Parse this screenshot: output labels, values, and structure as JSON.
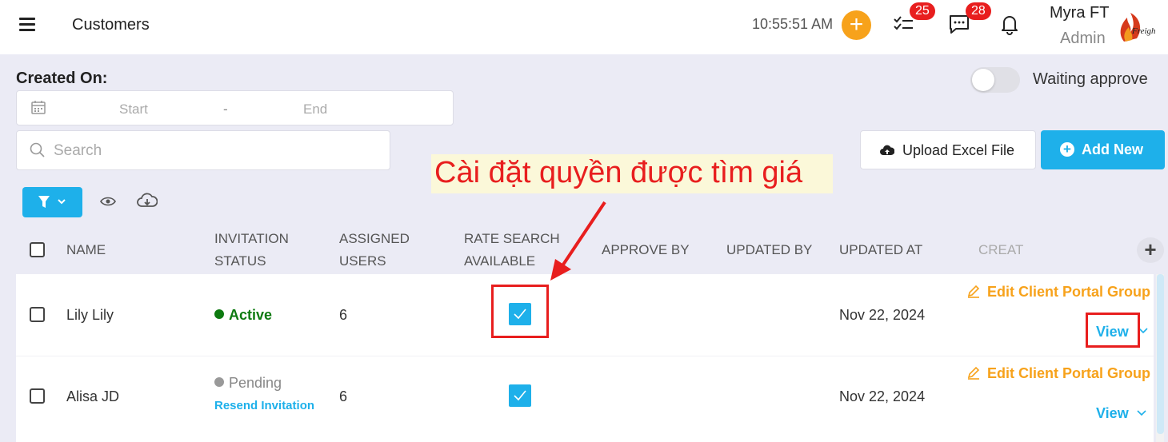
{
  "header": {
    "page_title": "Customers",
    "clock": "10:55:51 AM",
    "tasks_badge": "25",
    "messages_badge": "28",
    "user_name": "Myra FT",
    "user_role": "Admin",
    "icons": [
      "menu-icon",
      "add-icon",
      "checklist-icon",
      "chat-icon",
      "bell-icon"
    ]
  },
  "filters": {
    "created_on_label": "Created On:",
    "start_placeholder": "Start",
    "range_separator": "-",
    "end_placeholder": "End",
    "search_placeholder": "Search",
    "waiting_toggle_label": "Waiting approve",
    "waiting_toggle_on": false
  },
  "actions": {
    "upload_label": "Upload Excel File",
    "add_new_label": "Add New"
  },
  "annotation": {
    "text": "Cài đặt quyền được tìm giá"
  },
  "table": {
    "columns": {
      "name": "NAME",
      "invitation_status_1": "INVITATION",
      "invitation_status_2": "STATUS",
      "assigned_users_1": "ASSIGNED",
      "assigned_users_2": "USERS",
      "rate_search_1": "RATE SEARCH",
      "rate_search_2": "AVAILABLE",
      "approve_by": "APPROVE BY",
      "updated_by": "UPDATED BY",
      "updated_at": "UPDATED AT",
      "created": "CREAT"
    },
    "rows": [
      {
        "name": "Lily Lily",
        "status": "Active",
        "assigned_users": "6",
        "rate_search_available": true,
        "approve_by": "",
        "updated_by": "",
        "updated_at": "Nov 22, 2024",
        "edit_label": "Edit Client Portal Group",
        "view_label": "View"
      },
      {
        "name": "Alisa JD",
        "status": "Pending",
        "resend_label": "Resend Invitation",
        "assigned_users": "6",
        "rate_search_available": true,
        "approve_by": "",
        "updated_by": "",
        "updated_at": "Nov 22, 2024",
        "edit_label": "Edit Client Portal Group",
        "view_label": "View"
      }
    ]
  },
  "colors": {
    "accent": "#1eb0ea",
    "orange": "#f7a21b",
    "badge_red": "#e81e1e",
    "active_green": "#0d7a10",
    "pending_grey": "#999999"
  }
}
